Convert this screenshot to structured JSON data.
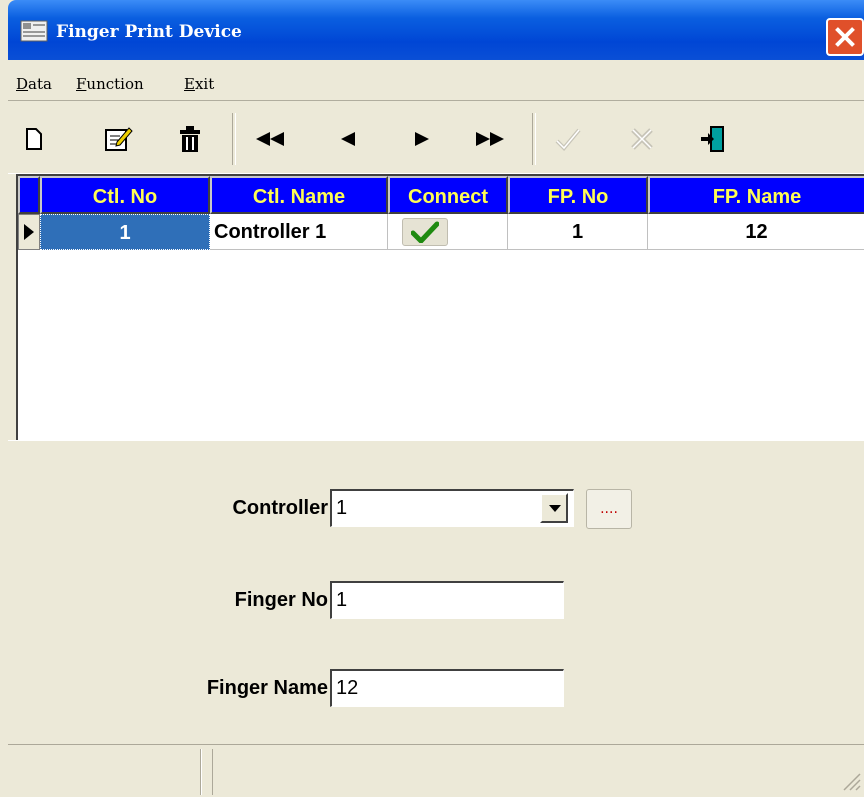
{
  "window": {
    "title": "Finger Print Device"
  },
  "menu": {
    "items": [
      {
        "label": "Data",
        "accel": "D",
        "rest": "ata"
      },
      {
        "label": "Function",
        "accel": "F",
        "rest": "unction"
      },
      {
        "label": "Exit",
        "accel": "E",
        "rest": "xit"
      }
    ]
  },
  "toolbar": {
    "buttons": [
      "new-icon",
      "edit-icon",
      "delete-icon",
      "first-record-icon",
      "prior-record-icon",
      "next-record-icon",
      "last-record-icon",
      "post-icon",
      "cancel-icon",
      "exit-icon"
    ]
  },
  "grid": {
    "headers": [
      "Ctl. No",
      "Ctl. Name",
      "Connect",
      "FP. No",
      "FP. Name"
    ],
    "rows": [
      {
        "ctl_no": "1",
        "ctl_name": "Controller 1",
        "connect": true,
        "fp_no": "1",
        "fp_name": "12"
      }
    ]
  },
  "form": {
    "controller_label": "Controller",
    "controller_value": "1",
    "ellipsis_label": "....",
    "finger_no_label": "Finger No",
    "finger_no_value": "1",
    "finger_name_label": "Finger Name",
    "finger_name_value": "12"
  },
  "colors": {
    "header_bg": "#0000ff",
    "header_text": "#fffd54",
    "selected": "#2f6fb8",
    "check": "#2a9a1a"
  }
}
